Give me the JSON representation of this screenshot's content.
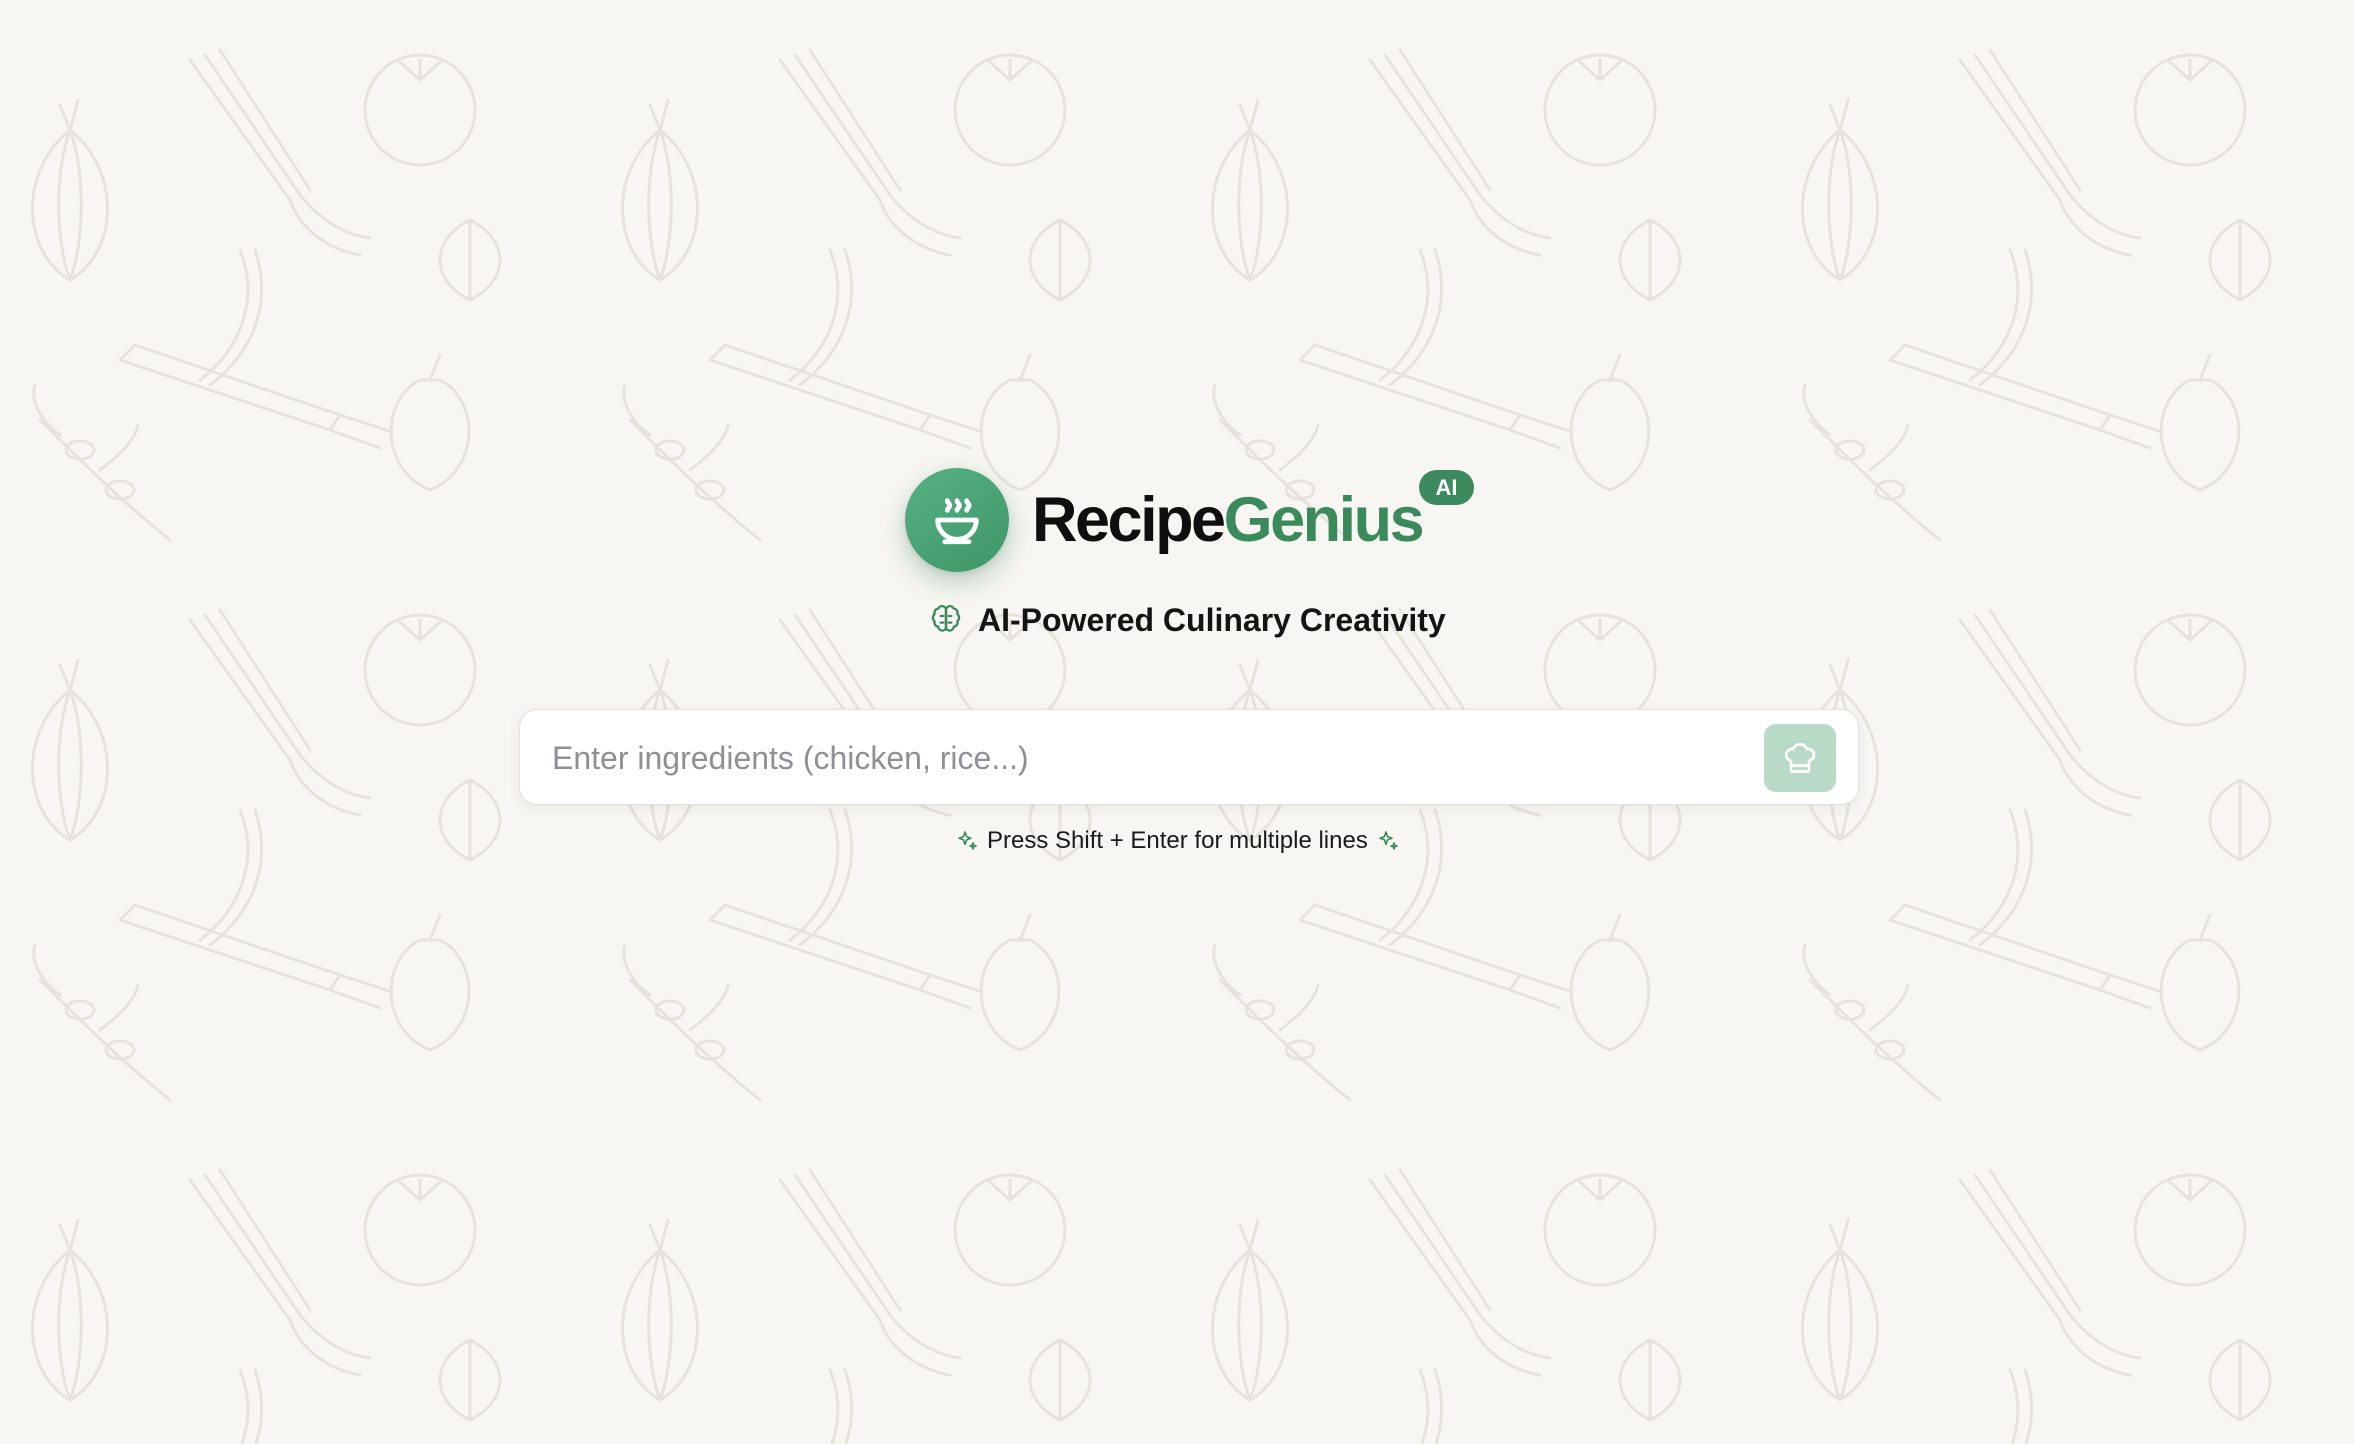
{
  "app": {
    "brand_part1": "Recipe",
    "brand_part2": "Genius",
    "badge": "AI",
    "tagline": "AI-Powered Culinary Creativity",
    "logo_icon": "steaming-bowl-icon",
    "tagline_icon": "brain-icon"
  },
  "search": {
    "placeholder": "Enter ingredients (chicken, rice...)",
    "value": "",
    "submit_icon": "chef-hat-icon"
  },
  "hint": {
    "text": "Press Shift + Enter for multiple lines",
    "icon": "sparkles-icon"
  },
  "colors": {
    "background": "#f8f6f2",
    "brand_green": "#3b8a5c",
    "logo_green": "#4ea677",
    "button_green_disabled": "#b9dac6",
    "text_dark": "#0f0f0f"
  }
}
